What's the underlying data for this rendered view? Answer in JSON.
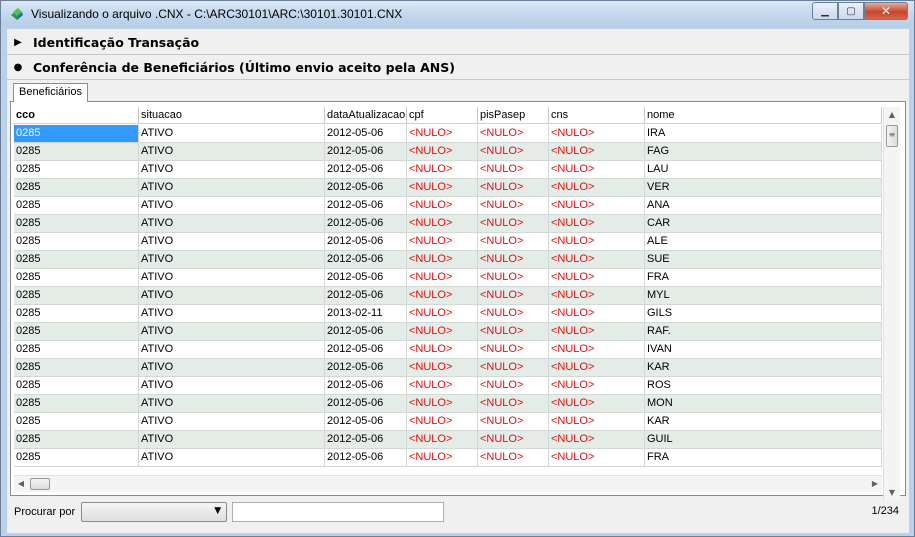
{
  "window": {
    "title": "Visualizando o arquivo .CNX - C:\\ARC30101\\ARC:\\30101.30101.CNX"
  },
  "sections": [
    {
      "label": "Identificação Transação",
      "state": "collapsed"
    },
    {
      "label": "Conferência de Beneficiários (Último envio aceito pela ANS)",
      "state": "expanded"
    }
  ],
  "tabs": [
    {
      "label": "Beneficiários"
    }
  ],
  "grid": {
    "columns": [
      "cco",
      "situacao",
      "dataAtualizacao",
      "cpf",
      "pisPasep",
      "cns",
      "nome"
    ],
    "null_label": "<NULO>",
    "rows": [
      [
        "0285",
        "ATIVO",
        "2012-05-06",
        "<NULO>",
        "<NULO>",
        "<NULO>",
        "IRA"
      ],
      [
        "0285",
        "ATIVO",
        "2012-05-06",
        "<NULO>",
        "<NULO>",
        "<NULO>",
        "FAG"
      ],
      [
        "0285",
        "ATIVO",
        "2012-05-06",
        "<NULO>",
        "<NULO>",
        "<NULO>",
        "LAU"
      ],
      [
        "0285",
        "ATIVO",
        "2012-05-06",
        "<NULO>",
        "<NULO>",
        "<NULO>",
        "VER"
      ],
      [
        "0285",
        "ATIVO",
        "2012-05-06",
        "<NULO>",
        "<NULO>",
        "<NULO>",
        "ANA"
      ],
      [
        "0285",
        "ATIVO",
        "2012-05-06",
        "<NULO>",
        "<NULO>",
        "<NULO>",
        "CAR"
      ],
      [
        "0285",
        "ATIVO",
        "2012-05-06",
        "<NULO>",
        "<NULO>",
        "<NULO>",
        "ALE"
      ],
      [
        "0285",
        "ATIVO",
        "2012-05-06",
        "<NULO>",
        "<NULO>",
        "<NULO>",
        "SUE"
      ],
      [
        "0285",
        "ATIVO",
        "2012-05-06",
        "<NULO>",
        "<NULO>",
        "<NULO>",
        "FRA"
      ],
      [
        "0285",
        "ATIVO",
        "2012-05-06",
        "<NULO>",
        "<NULO>",
        "<NULO>",
        "MYL"
      ],
      [
        "0285",
        "ATIVO",
        "2013-02-11",
        "<NULO>",
        "<NULO>",
        "<NULO>",
        "GILS"
      ],
      [
        "0285",
        "ATIVO",
        "2012-05-06",
        "<NULO>",
        "<NULO>",
        "<NULO>",
        "RAF."
      ],
      [
        "0285",
        "ATIVO",
        "2012-05-06",
        "<NULO>",
        "<NULO>",
        "<NULO>",
        "IVAN"
      ],
      [
        "0285",
        "ATIVO",
        "2012-05-06",
        "<NULO>",
        "<NULO>",
        "<NULO>",
        "KAR"
      ],
      [
        "0285",
        "ATIVO",
        "2012-05-06",
        "<NULO>",
        "<NULO>",
        "<NULO>",
        "ROS"
      ],
      [
        "0285",
        "ATIVO",
        "2012-05-06",
        "<NULO>",
        "<NULO>",
        "<NULO>",
        "MON"
      ],
      [
        "0285",
        "ATIVO",
        "2012-05-06",
        "<NULO>",
        "<NULO>",
        "<NULO>",
        "KAR"
      ],
      [
        "0285",
        "ATIVO",
        "2012-05-06",
        "<NULO>",
        "<NULO>",
        "<NULO>",
        "GUIL"
      ],
      [
        "0285",
        "ATIVO",
        "2012-05-06",
        "<NULO>",
        "<NULO>",
        "<NULO>",
        "FRA"
      ]
    ]
  },
  "footer": {
    "search_label": "Procurar por",
    "search_select_value": "",
    "search_input_value": "",
    "record_counter": "1/234"
  },
  "colors": {
    "null_text": "#e01010",
    "selected_cell": "#3399ff",
    "alt_row": "#e3ece6"
  },
  "icons": [
    "app-icon",
    "triangle-right-icon",
    "bullet-icon",
    "minimize-icon",
    "maximize-icon",
    "close-icon",
    "scroll-up-icon",
    "scroll-down-icon",
    "scroll-left-icon",
    "scroll-right-icon",
    "dropdown-arrow-icon"
  ]
}
